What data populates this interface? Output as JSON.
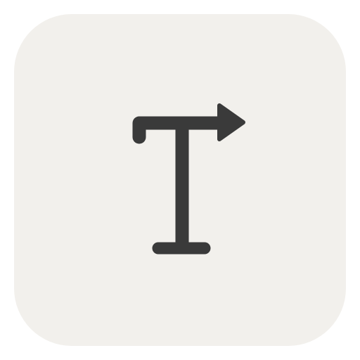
{
  "app_icon": {
    "icon": "text-direction-icon",
    "tile_color": "#f2f0ec",
    "glyph_color": "#3a3a3a"
  }
}
